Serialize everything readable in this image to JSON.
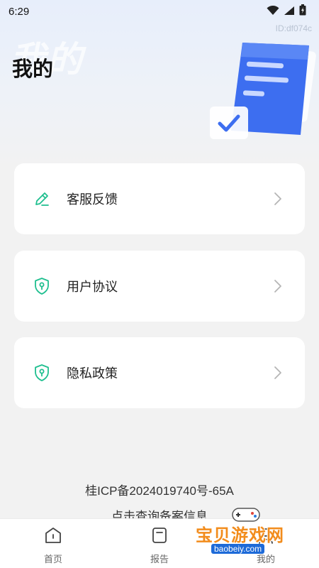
{
  "status_bar": {
    "time": "6:29",
    "icons": [
      "wifi-icon",
      "signal-icon",
      "battery-icon"
    ]
  },
  "device_id": "ID:df074c",
  "page": {
    "title": "我的",
    "title_shadow": "我的"
  },
  "menu": [
    {
      "label": "客服反馈",
      "icon": "edit-pencil-icon"
    },
    {
      "label": "用户协议",
      "icon": "shield-lock-icon"
    },
    {
      "label": "隐私政策",
      "icon": "shield-lock-icon"
    }
  ],
  "footer": {
    "icp": "桂ICP备2024019740号-65A",
    "record_link": "点击查询备案信息"
  },
  "tabs": [
    {
      "label": "首页",
      "icon": "home-icon"
    },
    {
      "label": "报告",
      "icon": "report-icon"
    },
    {
      "label": "我的",
      "icon": "profile-icon"
    }
  ],
  "watermark": {
    "brand": "宝贝游戏网",
    "url": "baobeiy.com"
  },
  "colors": {
    "accent_green": "#1fbf8f",
    "doc_blue": "#3d6ef0",
    "background": "#f2f2f2",
    "card": "#ffffff"
  }
}
